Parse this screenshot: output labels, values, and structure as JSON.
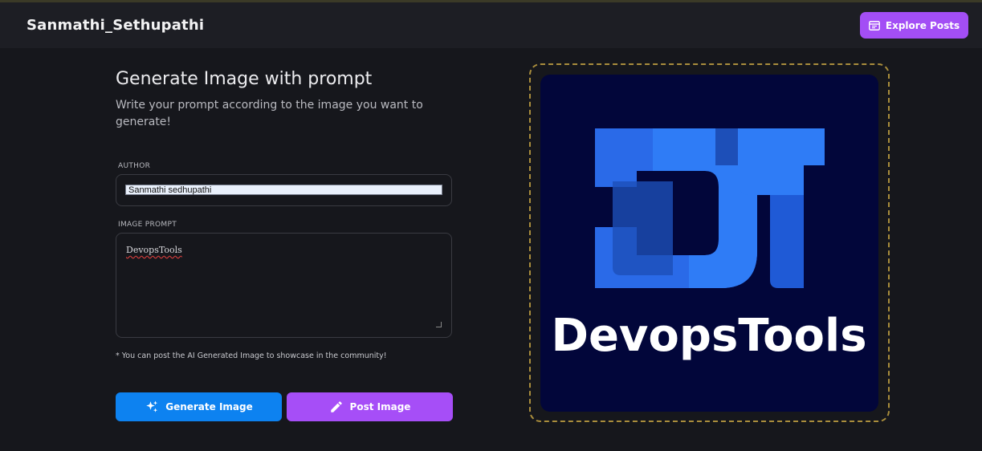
{
  "header": {
    "brand": "Sanmathi_Sethupathi",
    "explore_button": {
      "label": "Explore Posts",
      "icon": "explore-icon"
    }
  },
  "form": {
    "title": "Generate Image with prompt",
    "subtitle": "Write your prompt according to the image you want to generate!",
    "author": {
      "label": "AUTHOR",
      "value": "Sanmathi sedhupathi"
    },
    "prompt": {
      "label": "IMAGE PROMPT",
      "value": "DevopsTools"
    },
    "note": "* You can post the AI Generated Image to showcase in the community!",
    "generate_button": {
      "label": "Generate Image",
      "icon": "sparkles-icon"
    },
    "post_button": {
      "label": "Post Image",
      "icon": "pencil-icon"
    }
  },
  "preview": {
    "image_text": "DevopsTools",
    "background_color": "#02063a",
    "accent_color": "#2f7cf6"
  },
  "colors": {
    "page_bg": "#16171c",
    "primary_blue": "#0d82f0",
    "primary_purple": "#a64ef7"
  }
}
